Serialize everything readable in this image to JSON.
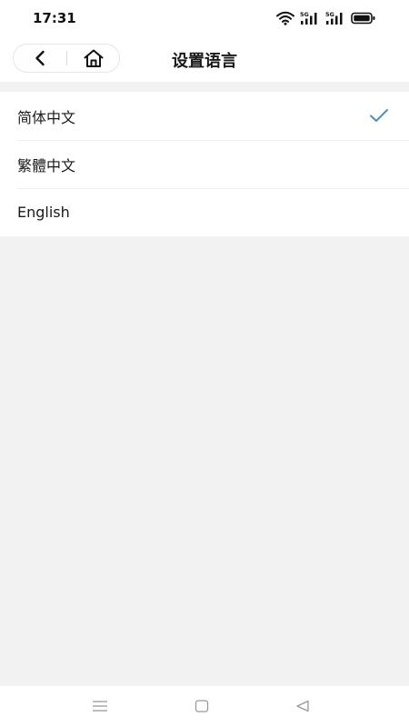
{
  "status_bar": {
    "time": "17:31",
    "icons": [
      "wifi-icon",
      "signal-5g-icon",
      "signal-5g-icon",
      "battery-icon"
    ]
  },
  "header": {
    "title": "设置语言",
    "back_icon": "chevron-left-icon",
    "home_icon": "home-icon"
  },
  "languages": {
    "items": [
      {
        "label": "简体中文",
        "selected": true
      },
      {
        "label": "繁體中文",
        "selected": false
      },
      {
        "label": "English",
        "selected": false
      }
    ]
  },
  "colors": {
    "accent": "#4a8ec9",
    "background": "#f2f2f2",
    "surface": "#ffffff",
    "text": "#1a1a1a"
  },
  "system_nav": {
    "icons": [
      "menu-icon",
      "home-square-icon",
      "back-triangle-icon"
    ]
  }
}
